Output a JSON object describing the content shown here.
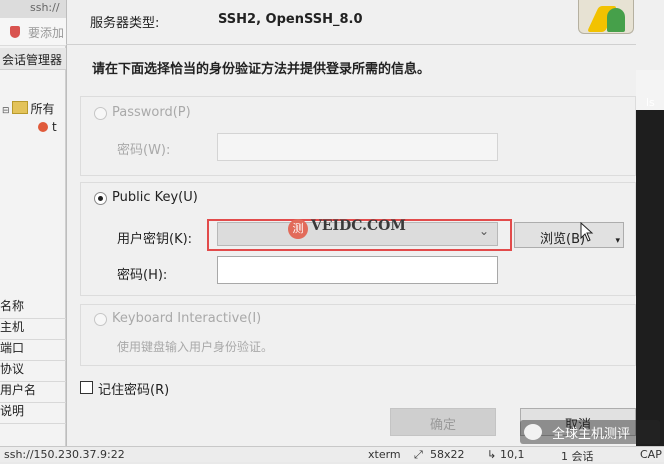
{
  "background_app": {
    "window_title": "ssh://",
    "toolbar_label": "要添加",
    "session_manager_tab": "会话管理器",
    "tree": {
      "root_label": "所有",
      "child_label": "t"
    },
    "properties": [
      "名称",
      "主机",
      "端口",
      "协议",
      "用户名",
      "说明"
    ],
    "right_panel_text": "ls"
  },
  "dialog": {
    "server_type_label": "服务器类型:",
    "server_type_value": "SSH2, OpenSSH_8.0",
    "instructions": "请在下面选择恰当的身份验证方法并提供登录所需的信息。",
    "password_method": {
      "label": "Password(P)",
      "field_label": "密码(W):",
      "enabled": false,
      "selected": false
    },
    "public_key_method": {
      "label": "Public Key(U)",
      "selected": true,
      "user_key_label": "用户密钥(K):",
      "user_key_value": "",
      "browse_button": "浏览(B)",
      "passphrase_label": "密码(H):",
      "passphrase_value": ""
    },
    "keyboard_method": {
      "label": "Keyboard Interactive(I)",
      "description": "使用键盘输入用户身份验证。",
      "enabled": false
    },
    "remember_password": {
      "label": "记住密码(R)",
      "checked": false
    },
    "ok_button": "确定",
    "cancel_button": "取消"
  },
  "watermarks": {
    "center_badge": "测",
    "center_text": "VEIDC.COM",
    "wechat_text": "全球主机测评"
  },
  "statusbar": {
    "connection": "ssh://150.230.37.9:22",
    "terminal": "xterm",
    "size": "58x22",
    "cursor": "10,1",
    "sessions": "1 会话",
    "extra": "CAP"
  },
  "colors": {
    "highlight_frame": "#e24b4b",
    "dialog_bg": "#f0f0f0"
  }
}
